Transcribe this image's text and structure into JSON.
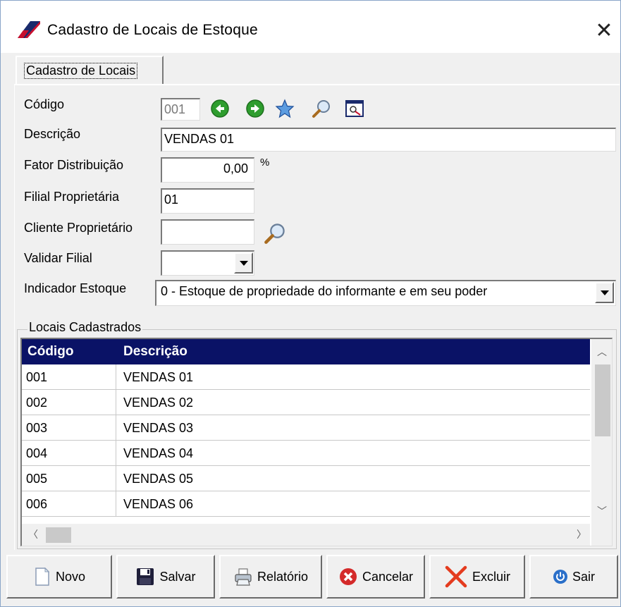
{
  "window": {
    "title": "Cadastro de Locais de Estoque",
    "close_glyph": "✕"
  },
  "tab": {
    "label": "Cadastro de Locais"
  },
  "form": {
    "codigo_label": "Código",
    "codigo_value": "001",
    "descricao_label": "Descrição",
    "descricao_value": "VENDAS 01",
    "fator_label": "Fator Distribuição",
    "fator_value": "0,00",
    "fator_unit": "%",
    "filial_label": "Filial Proprietária",
    "filial_value": "01",
    "cliente_label": "Cliente Proprietário",
    "cliente_value": "",
    "validar_label": "Validar Filial",
    "validar_value": "",
    "indicador_label": "Indicador Estoque",
    "indicador_value": "0 - Estoque de propriedade do informante e em seu poder"
  },
  "grid": {
    "group_title": "Locais Cadastrados",
    "columns": [
      "Código",
      "Descrição"
    ],
    "rows": [
      {
        "codigo": "001",
        "descricao": "VENDAS 01"
      },
      {
        "codigo": "002",
        "descricao": "VENDAS 02"
      },
      {
        "codigo": "003",
        "descricao": "VENDAS 03"
      },
      {
        "codigo": "004",
        "descricao": "VENDAS 04"
      },
      {
        "codigo": "005",
        "descricao": "VENDAS 05"
      },
      {
        "codigo": "006",
        "descricao": "VENDAS 06"
      }
    ]
  },
  "buttons": {
    "novo": "Novo",
    "salvar": "Salvar",
    "relatorio": "Relatório",
    "cancelar": "Cancelar",
    "excluir": "Excluir",
    "sair": "Sair"
  },
  "colors": {
    "grid_header": "#0a1266",
    "nav_green": "#2e9d2e",
    "cancel_red": "#d42a2a",
    "logo_red": "#c8102e",
    "logo_navy": "#1a2a6c"
  },
  "icons": [
    "app-logo-icon",
    "close-icon",
    "prev-record-icon",
    "next-record-icon",
    "favorite-star-icon",
    "search-icon",
    "preview-icon",
    "new-document-icon",
    "save-disk-icon",
    "printer-icon",
    "cancel-icon",
    "delete-x-icon",
    "power-icon"
  ]
}
